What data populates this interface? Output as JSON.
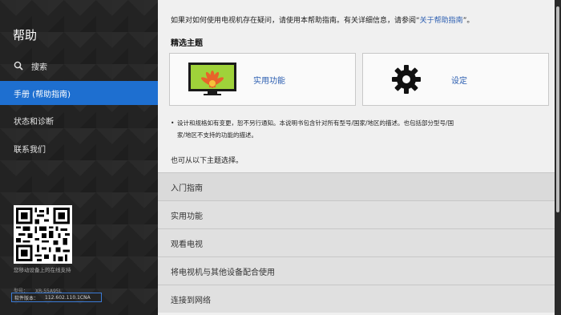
{
  "sidebar": {
    "title": "帮助",
    "items": [
      {
        "label": "搜索",
        "icon": "search-icon"
      },
      {
        "label": "手册 (帮助指南)",
        "active": true
      },
      {
        "label": "状态和诊断"
      },
      {
        "label": "联系我们"
      }
    ],
    "qr_caption": "您移动设备上的在线支持",
    "model_label": "型号：",
    "model_value": "XR-55A95L",
    "firmware_label": "软件版本：",
    "firmware_value": "112.602.110.1CNA"
  },
  "main": {
    "intro_prefix": "如果对如何使用电视机存在疑问，请使用本帮助指南。有关详细信息，请参阅“",
    "intro_link": "关于帮助指南",
    "intro_suffix": "”。",
    "featured_title": "精选主题",
    "cards": [
      {
        "label": "实用功能",
        "icon": "tv-flower-icon"
      },
      {
        "label": "设定",
        "icon": "gear-icon"
      }
    ],
    "note_line1": "设计和规格如有变更，恕不另行通知。本说明书包含针对所有型号/国家/地区的描述。也包括部分型号/国",
    "note_line2": "家/地区不支持的功能的描述。",
    "also_text": "也可从以下主题选择。",
    "topics": [
      "入门指南",
      "实用功能",
      "观看电视",
      "将电视机与其他设备配合使用",
      "连接到网络"
    ]
  },
  "colors": {
    "accent": "#1e6fd0",
    "link": "#2a5db0",
    "sidebar_bg": "#232323",
    "main_bg": "#f0f0f0"
  }
}
